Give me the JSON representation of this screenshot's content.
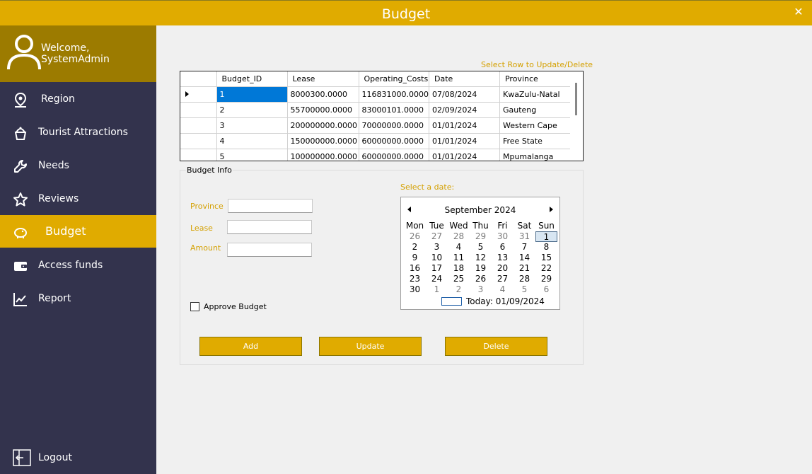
{
  "window": {
    "title": "Budget",
    "close_icon": "close-icon"
  },
  "sidebar": {
    "welcome": "Welcome, SystemAdmin",
    "items": [
      {
        "label": "Region",
        "icon": "map-pin-icon"
      },
      {
        "label": "Tourist Attractions",
        "icon": "attraction-icon"
      },
      {
        "label": "Needs",
        "icon": "wrench-icon"
      },
      {
        "label": "Reviews",
        "icon": "star-icon"
      },
      {
        "label": "Budget",
        "icon": "piggy-bank-icon",
        "active": true
      },
      {
        "label": "Access funds",
        "icon": "wallet-icon"
      },
      {
        "label": "Report",
        "icon": "chart-line-icon"
      }
    ],
    "logout": "Logout"
  },
  "main": {
    "hint": "Select Row to Update/Delete",
    "table": {
      "columns": [
        "Budget_ID",
        "Lease",
        "Operating_Costs",
        "Date",
        "Province"
      ],
      "rows": [
        [
          "1",
          "8000300.0000",
          "116831000.0000",
          "07/08/2024",
          "KwaZulu-Natal"
        ],
        [
          "2",
          "55700000.0000",
          "83000101.0000",
          "02/09/2024",
          "Gauteng"
        ],
        [
          "3",
          "200000000.0000",
          "70000000.0000",
          "01/01/2024",
          "Western Cape"
        ],
        [
          "4",
          "150000000.0000",
          "60000000.0000",
          "01/01/2024",
          "Free State"
        ],
        [
          "5",
          "100000000.0000",
          "60000000.0000",
          "01/01/2024",
          "Mpumalanga"
        ]
      ]
    },
    "group_title": "Budget Info",
    "fields": {
      "province_label": "Province",
      "lease_label": "Lease",
      "amount_label": "Amount",
      "province_value": "",
      "lease_value": "",
      "amount_value": ""
    },
    "approve_label": "Approve Budget",
    "date_label": "Select a date:",
    "calendar": {
      "month": "September 2024",
      "dow": [
        "Mon",
        "Tue",
        "Wed",
        "Thu",
        "Fri",
        "Sat",
        "Sun"
      ],
      "weeks": [
        [
          "26",
          "27",
          "28",
          "29",
          "30",
          "31",
          "1"
        ],
        [
          "2",
          "3",
          "4",
          "5",
          "6",
          "7",
          "8"
        ],
        [
          "9",
          "10",
          "11",
          "12",
          "13",
          "14",
          "15"
        ],
        [
          "16",
          "17",
          "18",
          "19",
          "20",
          "21",
          "22"
        ],
        [
          "23",
          "24",
          "25",
          "26",
          "27",
          "28",
          "29"
        ],
        [
          "30",
          "1",
          "2",
          "3",
          "4",
          "5",
          "6"
        ]
      ],
      "today": "Today: 01/09/2024"
    },
    "buttons": {
      "add": "Add",
      "update": "Update",
      "delete": "Delete"
    }
  },
  "colors": {
    "accent": "#e0ab00",
    "sidebar": "#33334d",
    "profile": "#9c7b00"
  }
}
